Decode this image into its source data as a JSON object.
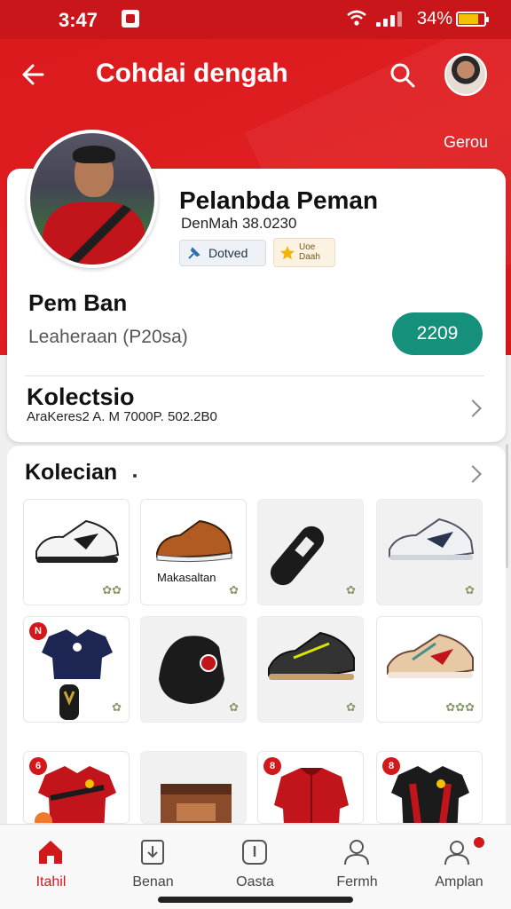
{
  "status_bar": {
    "time": "3:47",
    "battery_pct": "34%"
  },
  "app_bar": {
    "title": "Cohdai dengah",
    "right_link": "Gerou"
  },
  "profile": {
    "name": "Pelanbda Peman",
    "subtitle": "DenMah 38.0230",
    "badge_verified": "Dotved",
    "badge_gold_line1": "Uoe",
    "badge_gold_line2": "Daah",
    "section_title": "Pem Ban",
    "section_sub": "Leaheraan (P20sa)",
    "action_value": "2209",
    "collection_title": "Kolectsio",
    "collection_sub": "AraKeres2 A. M 7000P. 502.2B0"
  },
  "collection": {
    "title": "Kolecian",
    "tiles": [
      {
        "kind": "sneaker-white",
        "badge": "",
        "caption": "",
        "fav": "✿✿"
      },
      {
        "kind": "shoe-brown",
        "badge": "",
        "caption": "Makasaltan",
        "fav": "✿"
      },
      {
        "kind": "shinguard",
        "badge": "",
        "caption": "",
        "fav": "✿"
      },
      {
        "kind": "sneaker-gray",
        "badge": "",
        "caption": "",
        "fav": "✿"
      },
      {
        "kind": "jersey-navy",
        "badge": "N",
        "caption": "",
        "fav": "✿"
      },
      {
        "kind": "bag-black",
        "badge": "",
        "caption": "",
        "fav": "✿"
      },
      {
        "kind": "sneaker-dark",
        "badge": "",
        "caption": "",
        "fav": "✿"
      },
      {
        "kind": "sneaker-color",
        "badge": "",
        "caption": "",
        "fav": "✿✿✿"
      },
      {
        "kind": "jersey-red",
        "badge": "6",
        "caption": "",
        "fav": ""
      },
      {
        "kind": "box",
        "badge": "",
        "caption": "",
        "fav": ""
      },
      {
        "kind": "jacket-red",
        "badge": "8",
        "caption": "",
        "fav": ""
      },
      {
        "kind": "jersey-black",
        "badge": "8",
        "caption": "",
        "fav": ""
      }
    ]
  },
  "bottom_nav": [
    {
      "label": "Itahil",
      "icon": "home-icon",
      "active": true
    },
    {
      "label": "Benan",
      "icon": "inbox-icon",
      "active": false
    },
    {
      "label": "Oasta",
      "icon": "info-icon",
      "active": false
    },
    {
      "label": "Fermh",
      "icon": "person-icon",
      "active": false
    },
    {
      "label": "Amplan",
      "icon": "people-icon",
      "active": false
    }
  ],
  "colors": {
    "brand_red": "#d9191c",
    "accent_teal": "#15907a"
  }
}
